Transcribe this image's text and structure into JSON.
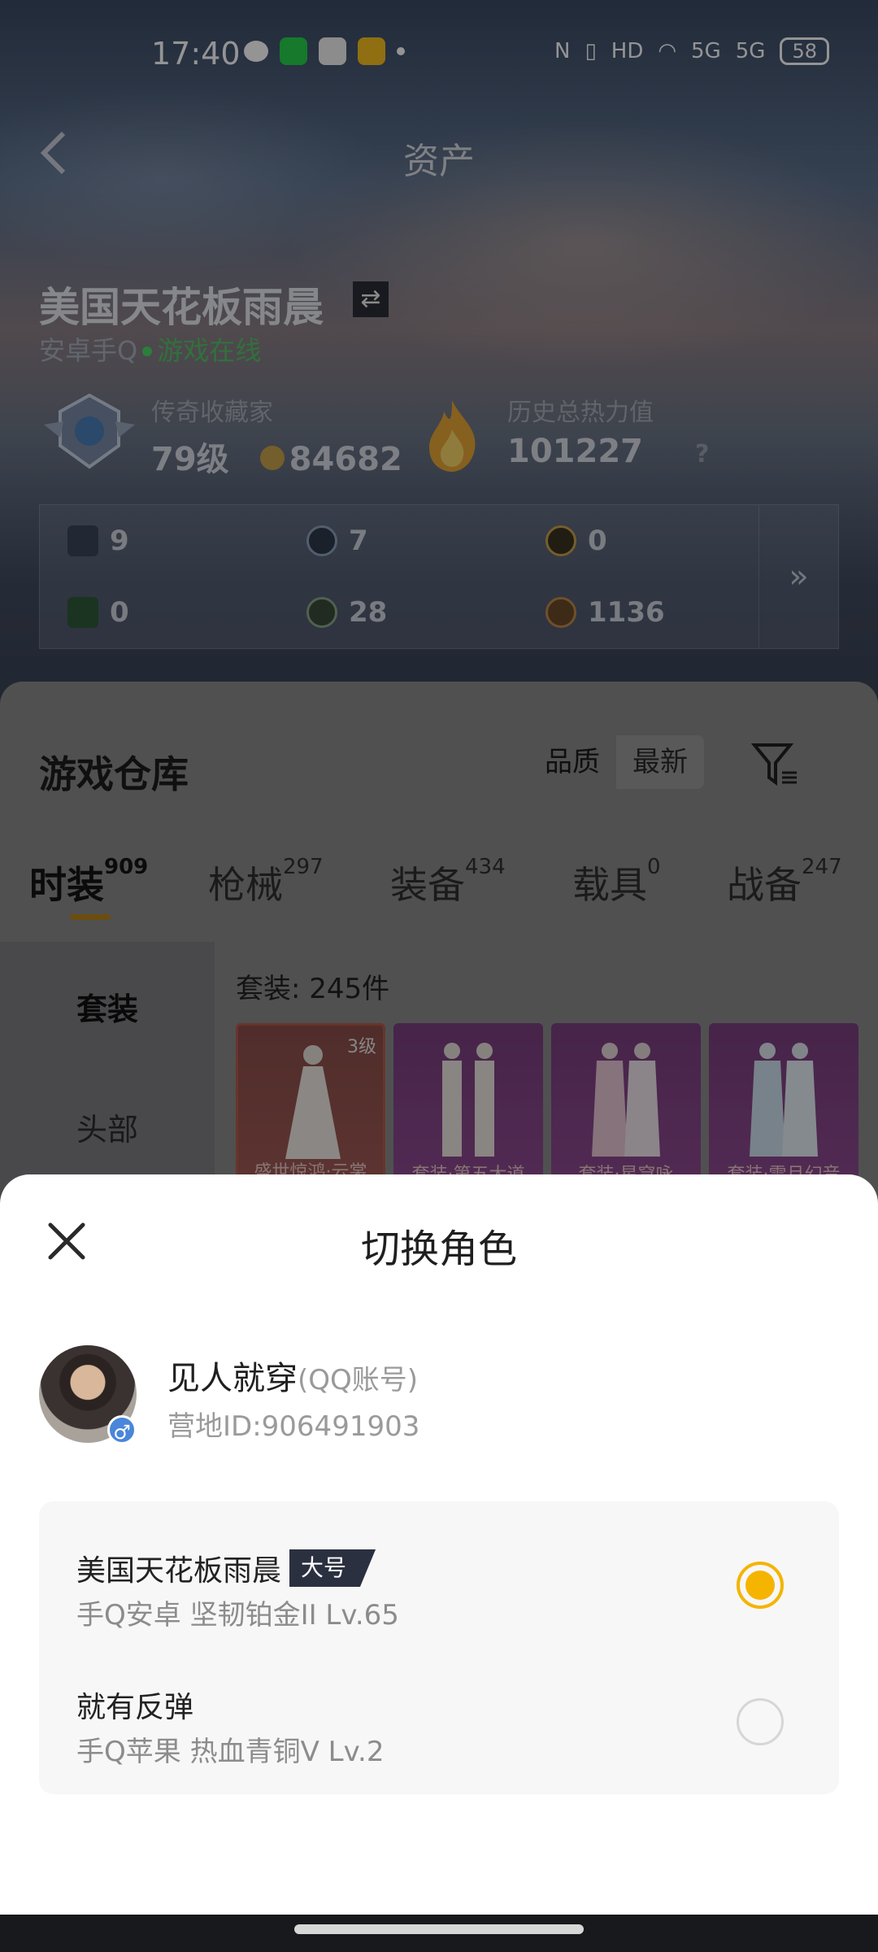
{
  "status_bar": {
    "time": "17:40",
    "battery": "58",
    "network": "5G"
  },
  "header": {
    "title": "资产"
  },
  "player": {
    "name": "美国天花板雨晨",
    "platform": "安卓手Q",
    "status": "游戏在线",
    "collector_label": "传奇收藏家",
    "level": "79级",
    "coins": "84682",
    "heat_label": "历史总热力值",
    "heat_value": "101227",
    "heat_help": "?"
  },
  "resources": [
    {
      "value": "9"
    },
    {
      "value": "7"
    },
    {
      "value": "0"
    },
    {
      "value": "0"
    },
    {
      "value": "28"
    },
    {
      "value": "1136"
    }
  ],
  "warehouse": {
    "title": "游戏仓库",
    "sort_quality": "品质",
    "sort_newest": "最新",
    "tabs": [
      {
        "label": "时装",
        "count": "909"
      },
      {
        "label": "枪械",
        "count": "297"
      },
      {
        "label": "装备",
        "count": "434"
      },
      {
        "label": "载具",
        "count": "0"
      },
      {
        "label": "战备",
        "count": "247"
      }
    ],
    "side_menu": [
      "套装",
      "头部"
    ],
    "set_count": "套装: 245件",
    "cards": [
      {
        "caption": "盛世惊鸿·云裳",
        "level": "3级"
      },
      {
        "caption": "套装·第五大道",
        "level": ""
      },
      {
        "caption": "套装·星穹咏",
        "level": ""
      },
      {
        "caption": "套装·雪月幻音",
        "level": ""
      }
    ]
  },
  "sheet": {
    "title": "切换角色",
    "account": {
      "name": "见人就穿",
      "type": "(QQ账号)",
      "camp_id": "营地ID:906491903",
      "gender": "♂"
    },
    "roles": [
      {
        "name": "美国天花板雨晨",
        "tag": "大号",
        "meta": "手Q安卓  坚韧铂金II  Lv.65",
        "selected": true
      },
      {
        "name": "就有反弹",
        "tag": "",
        "meta": "手Q苹果  热血青铜V  Lv.2",
        "selected": false
      }
    ]
  },
  "colors": {
    "accent": "#f5b400",
    "online": "#4cd964"
  }
}
